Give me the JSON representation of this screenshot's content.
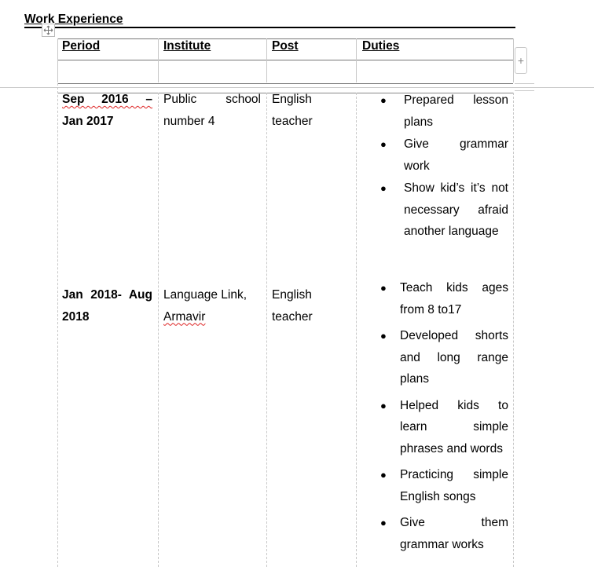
{
  "section": {
    "title": "Work Experience"
  },
  "table": {
    "headers": [
      "Period",
      "Institute",
      "Post",
      "Duties"
    ],
    "rows": [
      {
        "period": [
          "Sep 2016 –",
          "Jan 2017"
        ],
        "institute": [
          "Public school",
          "number 4"
        ],
        "post": [
          "English",
          "teacher"
        ],
        "duties": [
          [
            "Prepared lesson",
            "plans"
          ],
          [
            "Give grammar",
            "work"
          ],
          [
            "Show kid’s it’s not",
            "necessary afraid",
            "another language"
          ]
        ]
      },
      {
        "period": [
          "Jan 2018- Aug",
          "2018"
        ],
        "institute": [
          "Language Link,",
          "Armavir"
        ],
        "post": [
          "English",
          "teacher"
        ],
        "duties": [
          [
            "Teach kids ages",
            "from 8 to17"
          ],
          [
            "Developed shorts",
            "and long range",
            "plans"
          ],
          [
            "Helped kids to",
            "learn simple",
            "phrases and words"
          ],
          [
            "Practicing simple",
            "English songs"
          ],
          [
            "Give them",
            "grammar works"
          ]
        ]
      }
    ]
  },
  "icons": {
    "move": "move-handle-icon",
    "add": "plus-icon"
  }
}
